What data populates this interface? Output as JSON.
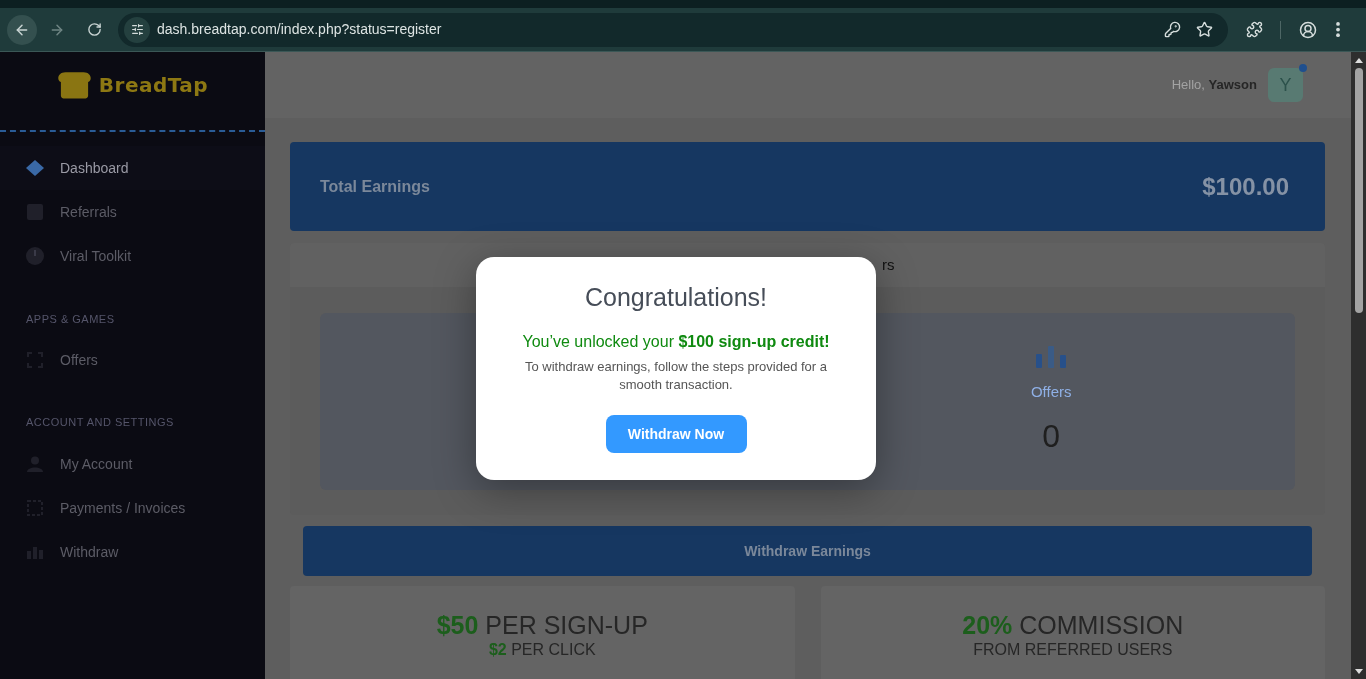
{
  "browser": {
    "url": "dash.breadtap.com/index.php?status=register"
  },
  "sidebar": {
    "logo": "BreadTap",
    "sections": [
      {
        "items": [
          {
            "label": "Dashboard",
            "selected": true
          },
          {
            "label": "Referrals",
            "selected": false
          },
          {
            "label": "Viral Toolkit",
            "selected": false
          }
        ]
      },
      {
        "heading": "APPS & GAMES",
        "items": [
          {
            "label": "Offers",
            "selected": false
          }
        ]
      },
      {
        "heading": "ACCOUNT AND SETTINGS",
        "items": [
          {
            "label": "My Account",
            "selected": false
          },
          {
            "label": "Payments / Invoices",
            "selected": false
          },
          {
            "label": "Withdraw",
            "selected": false
          }
        ]
      }
    ]
  },
  "header": {
    "greeting": "Hello, **Yawson**",
    "avatar_initial": "Y"
  },
  "total_earnings": {
    "label": "Total Earnings",
    "amount": "$100.00"
  },
  "stats": {
    "heading": "rs",
    "offers": {
      "label": "Offers",
      "value": "0"
    }
  },
  "withdraw_earnings_button": "Withdraw Earnings",
  "promo_cards": [
    {
      "headline": "**$50** PER SIGN-UP",
      "subline": "**$2** PER CLICK"
    },
    {
      "headline": "**20%** COMMISSION",
      "subline": "FROM REFERRED USERS"
    }
  ],
  "modal": {
    "title": "Congratulations!",
    "highlight": "You’ve unlocked your **$100 sign-up credit!**",
    "message": "To withdraw earnings, follow the steps provided for a smooth transaction.",
    "button": "Withdraw Now"
  }
}
